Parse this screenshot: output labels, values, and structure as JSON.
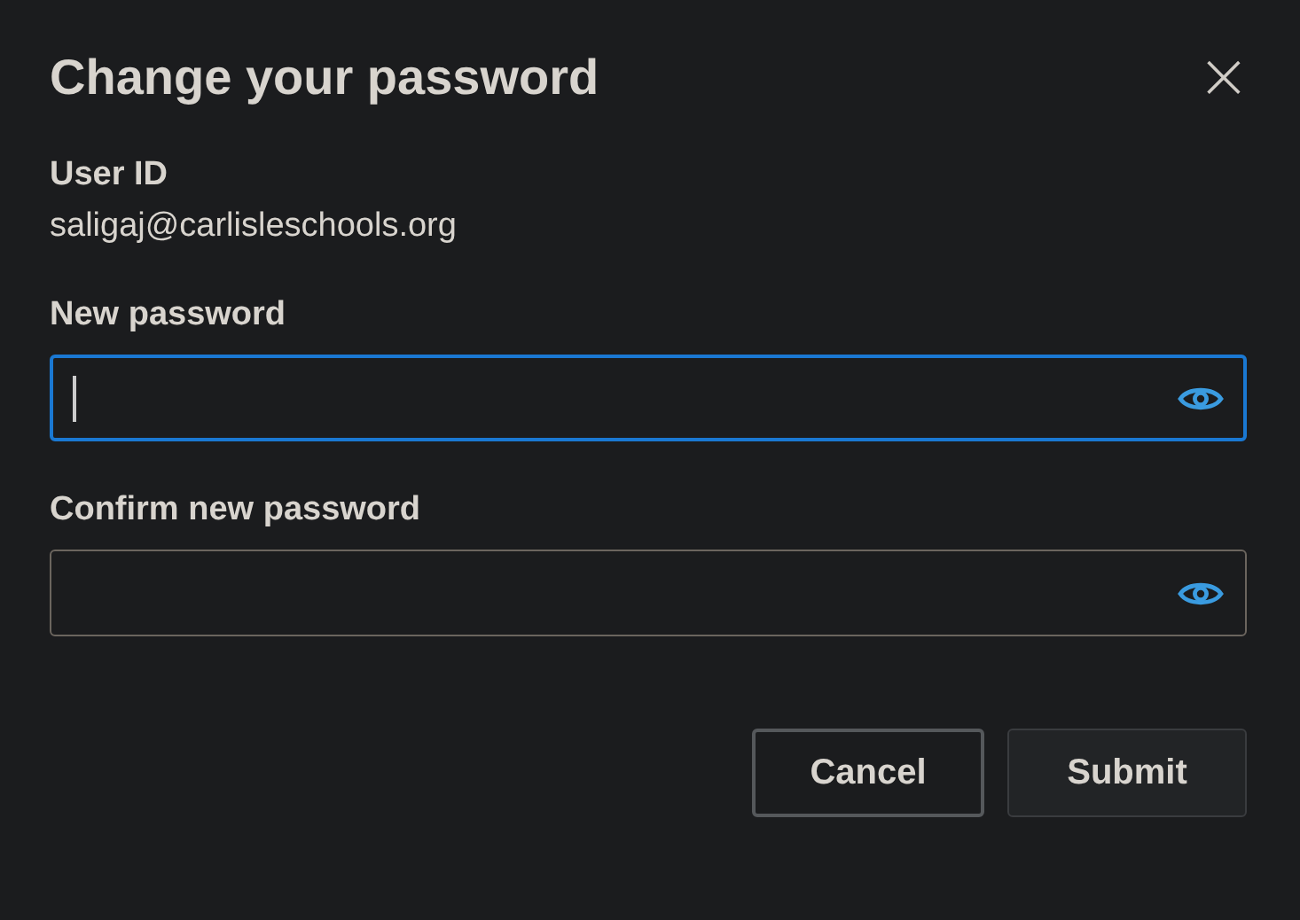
{
  "dialog": {
    "title": "Change your password",
    "close": "×"
  },
  "user": {
    "label": "User ID",
    "value": "saligaj@carlisleschools.org"
  },
  "fields": [
    {
      "label": "New password",
      "focused": true
    },
    {
      "label": "Confirm new password",
      "focused": false
    }
  ],
  "buttons": [
    {
      "label": "Cancel",
      "kind": "secondary"
    },
    {
      "label": "Submit",
      "kind": "primary"
    }
  ]
}
